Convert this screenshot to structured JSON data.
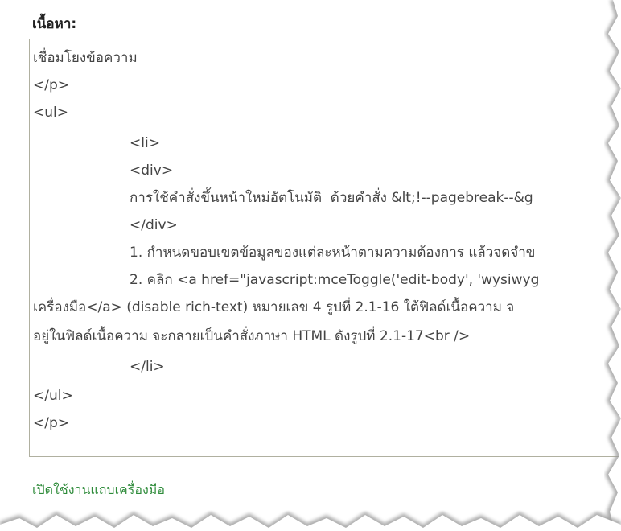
{
  "field": {
    "label": "เนื้อหา:"
  },
  "editor": {
    "lines": [
      "เชื่อมโยงข้อความ",
      "</p>",
      "<ul>",
      "<li>",
      "<div>",
      "การใช้คำสั่งขึ้นหน้าใหม่อัตโนมัติ  ด้วยคำสั่ง &lt;!--pagebreak--&g",
      "</div>",
      "1. กำหนดขอบเขตข้อมูลของแต่ละหน้าตามความต้องการ แล้วจดจำข",
      "2. คลิก <a href=\"javascript:mceToggle('edit-body', 'wysiwyg",
      "เครื่องมือ</a> (disable rich-text) หมายเลข 4 รูปที่ 2.1-16 ใต้ฟิลด์เนื้อความ จ",
      "อยู่ในฟิลด์เนื้อความ จะกลายเป็นคำสั่งภาษา HTML ดังรูปที่ 2.1-17<br />",
      "</li>",
      "</ul>",
      "</p>"
    ]
  },
  "links": {
    "toggle_toolbar": "เปิดใช้งานแถบเครื่องมือ"
  }
}
